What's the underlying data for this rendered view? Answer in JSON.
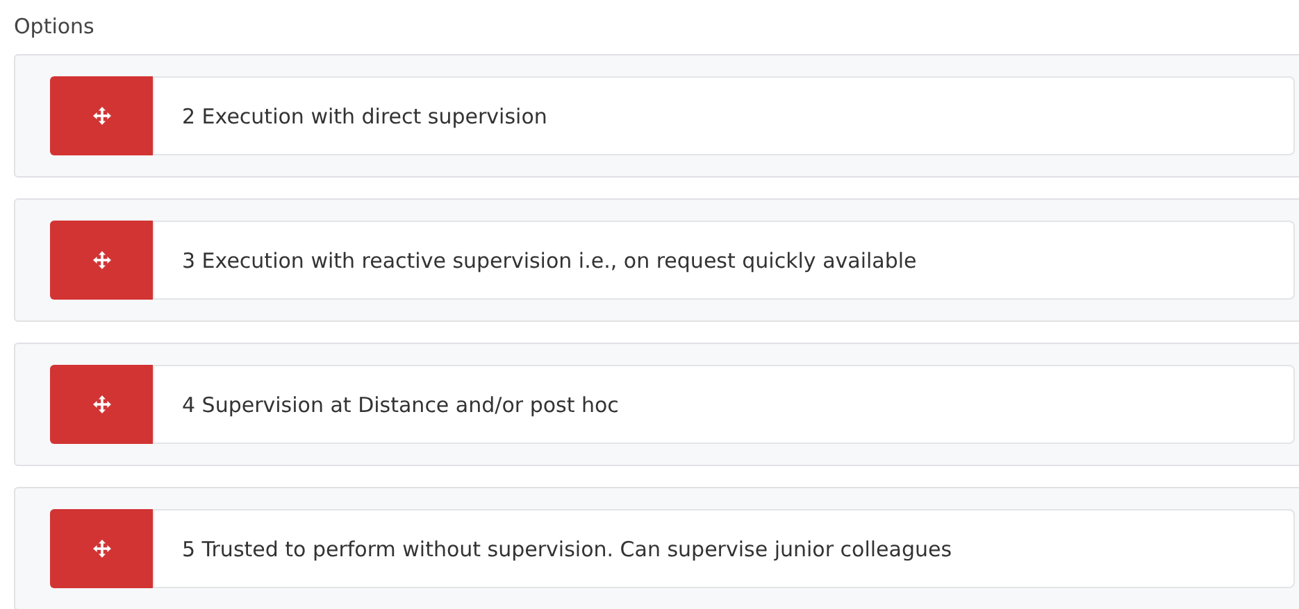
{
  "title": "Options",
  "options": [
    {
      "label": "2 Execution with direct supervision"
    },
    {
      "label": "3 Execution with reactive supervision i.e., on request quickly available"
    },
    {
      "label": "4 Supervision at Distance and/or post hoc"
    },
    {
      "label": "5 Trusted to perform without supervision. Can supervise junior colleagues"
    }
  ]
}
